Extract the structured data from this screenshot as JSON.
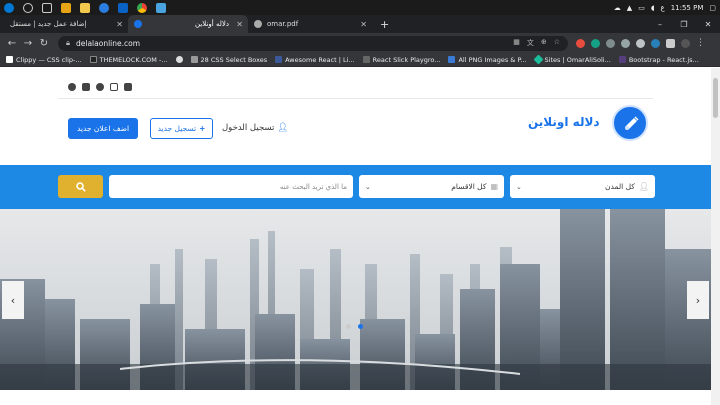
{
  "taskbar": {
    "clock": "11:55 PM",
    "lang": "ع",
    "icon_colors": [
      "#0078d4",
      "#cccccc",
      "#e8a317",
      "#f2c94c",
      "#2a7de1",
      "#0a62c4",
      "#777777",
      "#4aa3df"
    ]
  },
  "browser": {
    "tabs": [
      {
        "title": "إضافة عمل جديد | مستقل",
        "favicon_color": "#1d8cf8",
        "active": false
      },
      {
        "title": "دلاله أونلاين",
        "favicon_color": "#1a73e8",
        "active": true
      },
      {
        "title": "omar.pdf",
        "favicon_color": "#aaaaaa",
        "active": false
      }
    ],
    "new_tab": "+",
    "url": "delalaonline.com",
    "bookmarks": [
      {
        "label": "Clippy — CSS clip-...",
        "color": "#ffffff"
      },
      {
        "label": "THEMELOCK.COM -...",
        "color": "#222222"
      },
      {
        "label": "",
        "color": "#dddddd"
      },
      {
        "label": "28 CSS Select Boxes",
        "color": "#999999"
      },
      {
        "label": "Awesome React | Li...",
        "color": "#3b5998"
      },
      {
        "label": "React Slick Playgro...",
        "color": "#666666"
      },
      {
        "label": "All PNG Images & P...",
        "color": "#3a7bd5"
      },
      {
        "label": "Sites | OmarAliSoli...",
        "color": "#1abc9c"
      },
      {
        "label": "Bootstrap - React.js...",
        "color": "#563d7c"
      }
    ]
  },
  "site": {
    "brand": "دلاله اونلاين",
    "login": "تسجيل الدخول",
    "register": "تسجيل جديد",
    "post_ad": "اضف اعلان جديد",
    "search": {
      "placeholder": "ما الذي تريد البحث عنه",
      "category": "كل الاقسام",
      "city": "كل المدن"
    },
    "social_icons": [
      "facebook-icon",
      "twitter-icon",
      "snapchat-icon",
      "instagram-icon",
      "linkedin-icon"
    ],
    "slider": {
      "total": 2,
      "active": 2
    }
  },
  "colors": {
    "primary": "#1a73e8",
    "band": "#1e88e5",
    "search_button": "#e0b12f"
  }
}
